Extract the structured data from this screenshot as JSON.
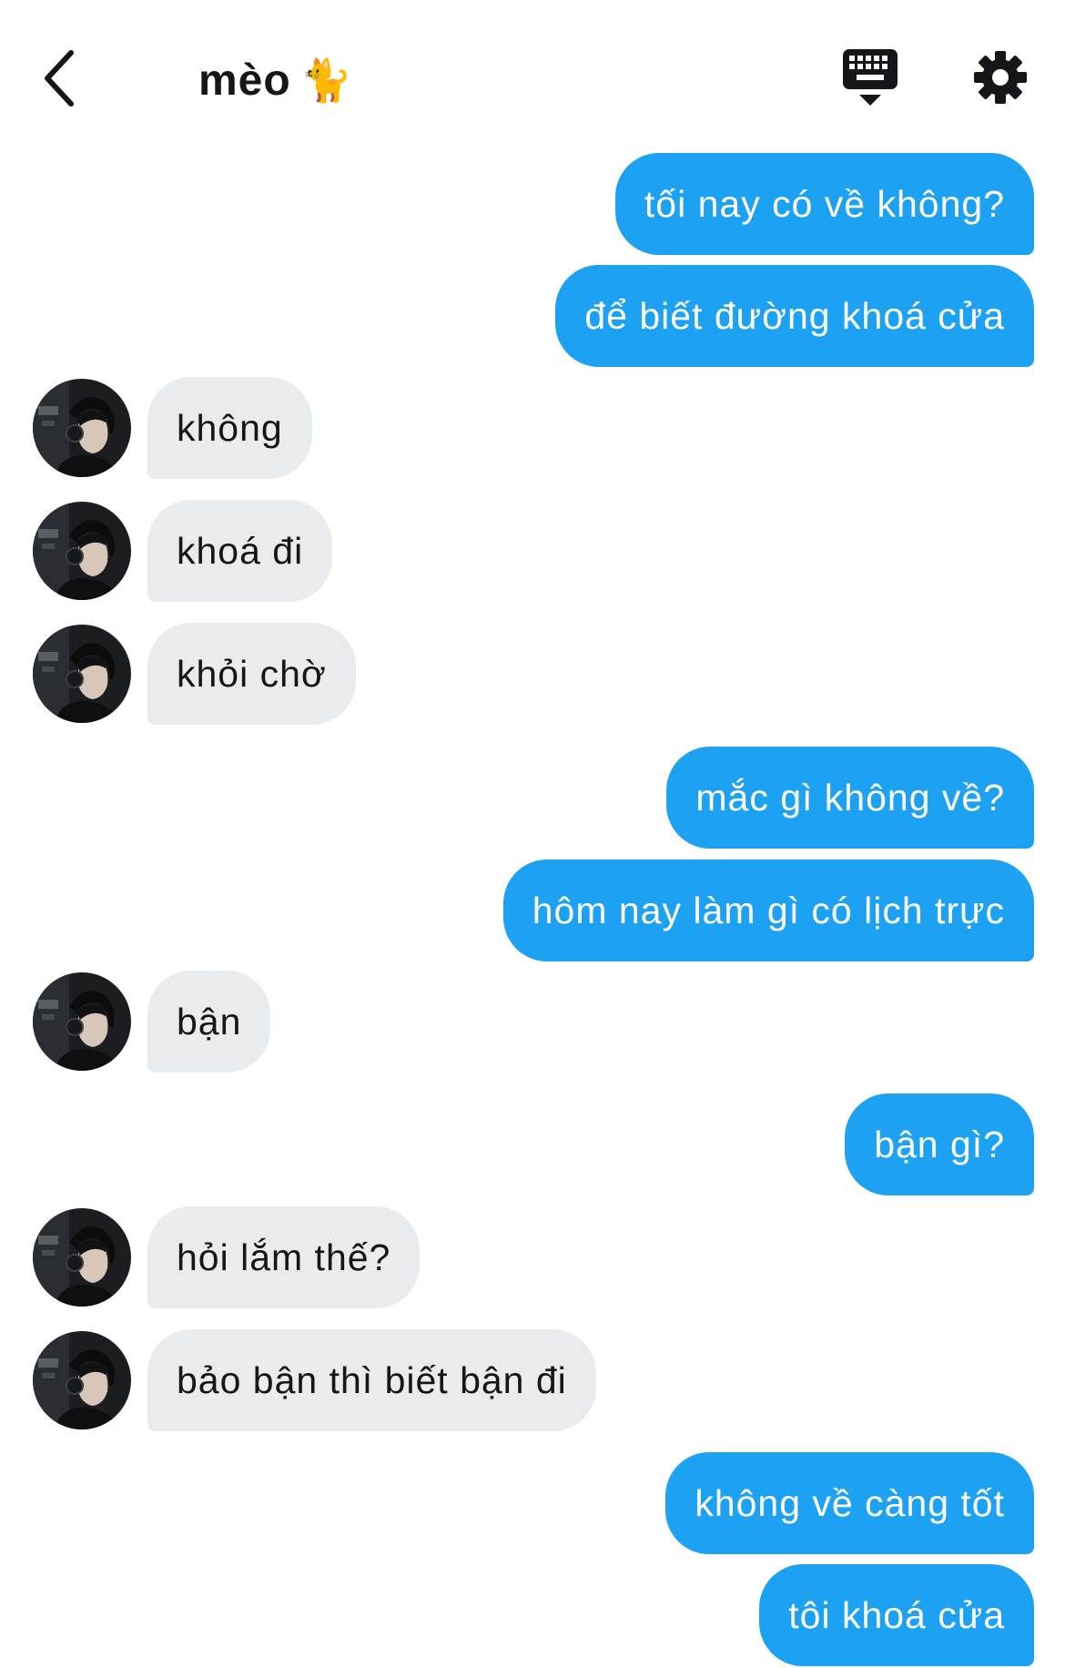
{
  "header": {
    "title": "mèo",
    "title_emoji": "🐈"
  },
  "messages": [
    {
      "from": "me",
      "text": "tối nay có về không?"
    },
    {
      "from": "me",
      "text": "để biết đường khoá cửa"
    },
    {
      "from": "them",
      "text": "không"
    },
    {
      "from": "them",
      "text": "khoá đi"
    },
    {
      "from": "them",
      "text": "khỏi chờ"
    },
    {
      "from": "me",
      "text": "mắc gì không về?"
    },
    {
      "from": "me",
      "text": "hôm nay làm gì có lịch trực"
    },
    {
      "from": "them",
      "text": "bận"
    },
    {
      "from": "me",
      "text": "bận gì?"
    },
    {
      "from": "them",
      "text": "hỏi lắm thế?"
    },
    {
      "from": "them",
      "text": "bảo bận thì biết bận đi"
    },
    {
      "from": "me",
      "text": "không về càng tốt"
    },
    {
      "from": "me",
      "text": "tôi khoá cửa"
    }
  ],
  "colors": {
    "sent_bubble": "#1da1f2",
    "received_bubble": "#e9ecef",
    "background": "#ffffff"
  },
  "icons": {
    "back": "chevron-left-icon",
    "keyboard": "keyboard-icon",
    "settings": "gear-icon"
  }
}
